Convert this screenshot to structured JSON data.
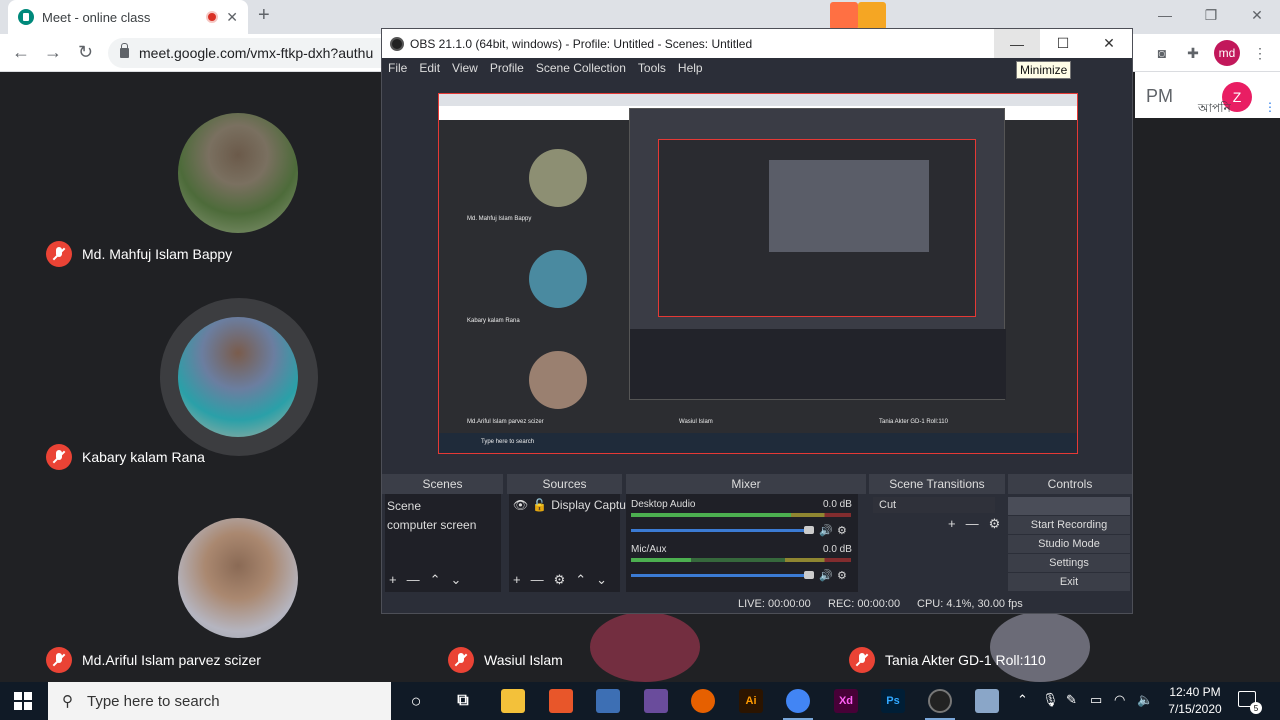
{
  "chrome": {
    "tab_title": "Meet - online class",
    "tab_close": "✕",
    "new_tab": "+",
    "url": "meet.google.com/vmx-ftkp-dxh?authu",
    "profile_initials": "md"
  },
  "meet": {
    "time": "PM",
    "user_initial": "Z",
    "bengali_label": "আপনি",
    "participants": [
      {
        "name": "Md. Mahfuj Islam Bappy"
      },
      {
        "name": "Kabary kalam Rana"
      },
      {
        "name": "Md.Ariful Islam parvez scizer"
      },
      {
        "name": "Wasiul Islam"
      },
      {
        "name": "Tania Akter GD-1 Roll:110"
      }
    ]
  },
  "obs": {
    "title": "OBS 21.1.0 (64bit, windows) - Profile: Untitled - Scenes: Untitled",
    "tooltip": "Minimize",
    "menu": [
      "File",
      "Edit",
      "View",
      "Profile",
      "Scene Collection",
      "Tools",
      "Help"
    ],
    "docks": {
      "scenes": {
        "header": "Scenes",
        "items": [
          "Scene",
          "computer screen"
        ]
      },
      "sources": {
        "header": "Sources",
        "items": [
          "Display Capture"
        ]
      },
      "mixer": {
        "header": "Mixer",
        "channels": [
          {
            "name": "Desktop Audio",
            "db": "0.0 dB"
          },
          {
            "name": "Mic/Aux",
            "db": "0.0 dB"
          }
        ]
      },
      "transitions": {
        "header": "Scene Transitions",
        "selected": "Cut"
      },
      "controls": {
        "header": "Controls",
        "buttons": [
          "Start Recording",
          "Studio Mode",
          "Settings",
          "Exit"
        ]
      }
    },
    "status": {
      "live": "LIVE: 00:00:00",
      "rec": "REC: 00:00:00",
      "cpu": "CPU: 4.1%, 30.00 fps"
    },
    "preview": {
      "labels": [
        "Md. Mahfuj Islam Bappy",
        "Kabary kalam Rana",
        "Md.Ariful Islam parvez scizer",
        "Wasiul Islam",
        "Tania Akter GD-1 Roll:110"
      ],
      "search": "Type here to search"
    }
  },
  "taskbar": {
    "search_placeholder": "Type here to search",
    "time": "12:40 PM",
    "date": "7/15/2020",
    "notifications": "5",
    "apps": [
      "Ai",
      "Xd",
      "Ps"
    ]
  }
}
